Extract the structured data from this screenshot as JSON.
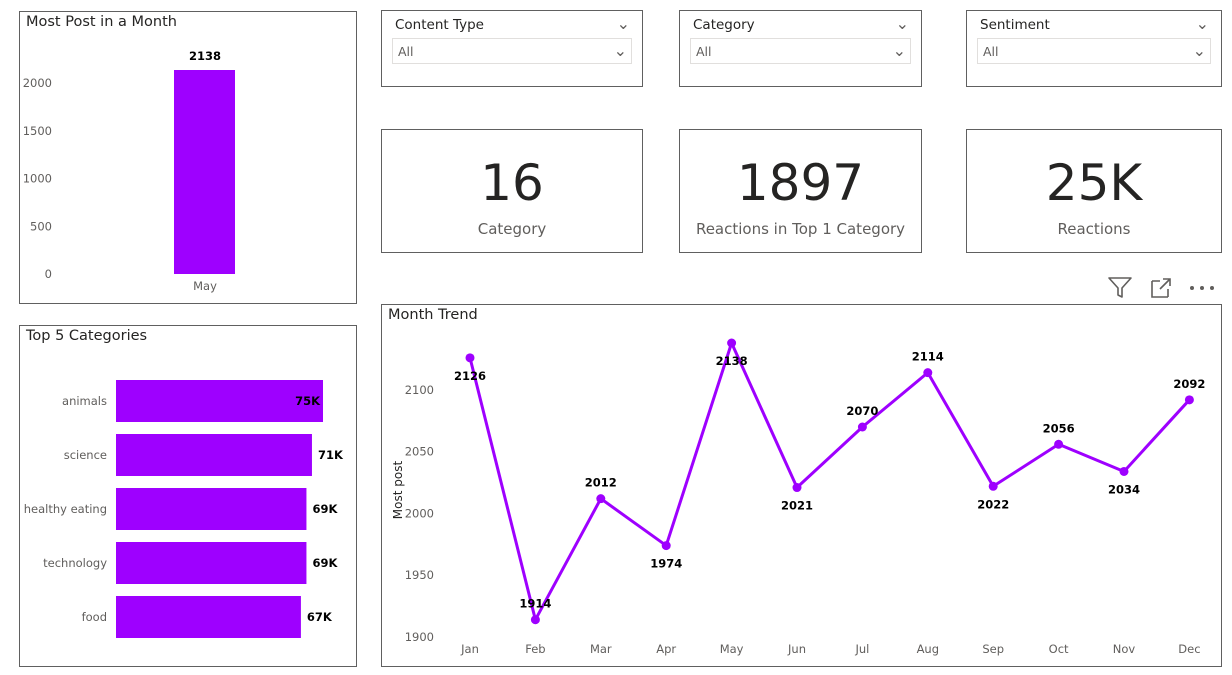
{
  "theme": {
    "accent": "#9E00FF",
    "border": "#606060",
    "text": "#252423",
    "muted": "#605e5c"
  },
  "most_post_panel": {
    "title": "Most Post in a Month",
    "chart_data": {
      "type": "bar",
      "categories": [
        "May"
      ],
      "values": [
        2138
      ],
      "data_labels": [
        "2138"
      ],
      "yticks": [
        0,
        500,
        1000,
        1500,
        2000
      ],
      "ylim": [
        0,
        2138
      ]
    }
  },
  "slicers": [
    {
      "label": "Content Type",
      "value": "All"
    },
    {
      "label": "Category",
      "value": "All"
    },
    {
      "label": "Sentiment",
      "value": "All"
    }
  ],
  "cards": [
    {
      "value": "16",
      "label": "Category"
    },
    {
      "value": "1897",
      "label": "Reactions in Top 1 Category"
    },
    {
      "value": "25K",
      "label": "Reactions"
    }
  ],
  "toolbar": {
    "filter_icon": "filter-icon",
    "focus_icon": "focus-mode-icon",
    "more_icon": "more-options-icon"
  },
  "top5_panel": {
    "title": "Top 5 Categories",
    "chart_data": {
      "type": "bar",
      "orientation": "horizontal",
      "categories": [
        "animals",
        "science",
        "healthy eating",
        "technology",
        "food"
      ],
      "values": [
        75,
        71,
        69,
        69,
        67
      ],
      "data_labels": [
        "75K",
        "71K",
        "69K",
        "69K",
        "67K"
      ],
      "unit": "K"
    }
  },
  "trend_panel": {
    "title": "Month Trend",
    "chart_data": {
      "type": "line",
      "categories": [
        "Jan",
        "Feb",
        "Mar",
        "Apr",
        "May",
        "Jun",
        "Jul",
        "Aug",
        "Sep",
        "Oct",
        "Nov",
        "Dec"
      ],
      "values": [
        2126,
        1914,
        2012,
        1974,
        2138,
        2021,
        2070,
        2114,
        2022,
        2056,
        2034,
        2092
      ],
      "ylabel": "Most post",
      "yticks": [
        1900,
        1950,
        2000,
        2050,
        2100
      ],
      "ylim": [
        1900,
        2138
      ]
    }
  }
}
